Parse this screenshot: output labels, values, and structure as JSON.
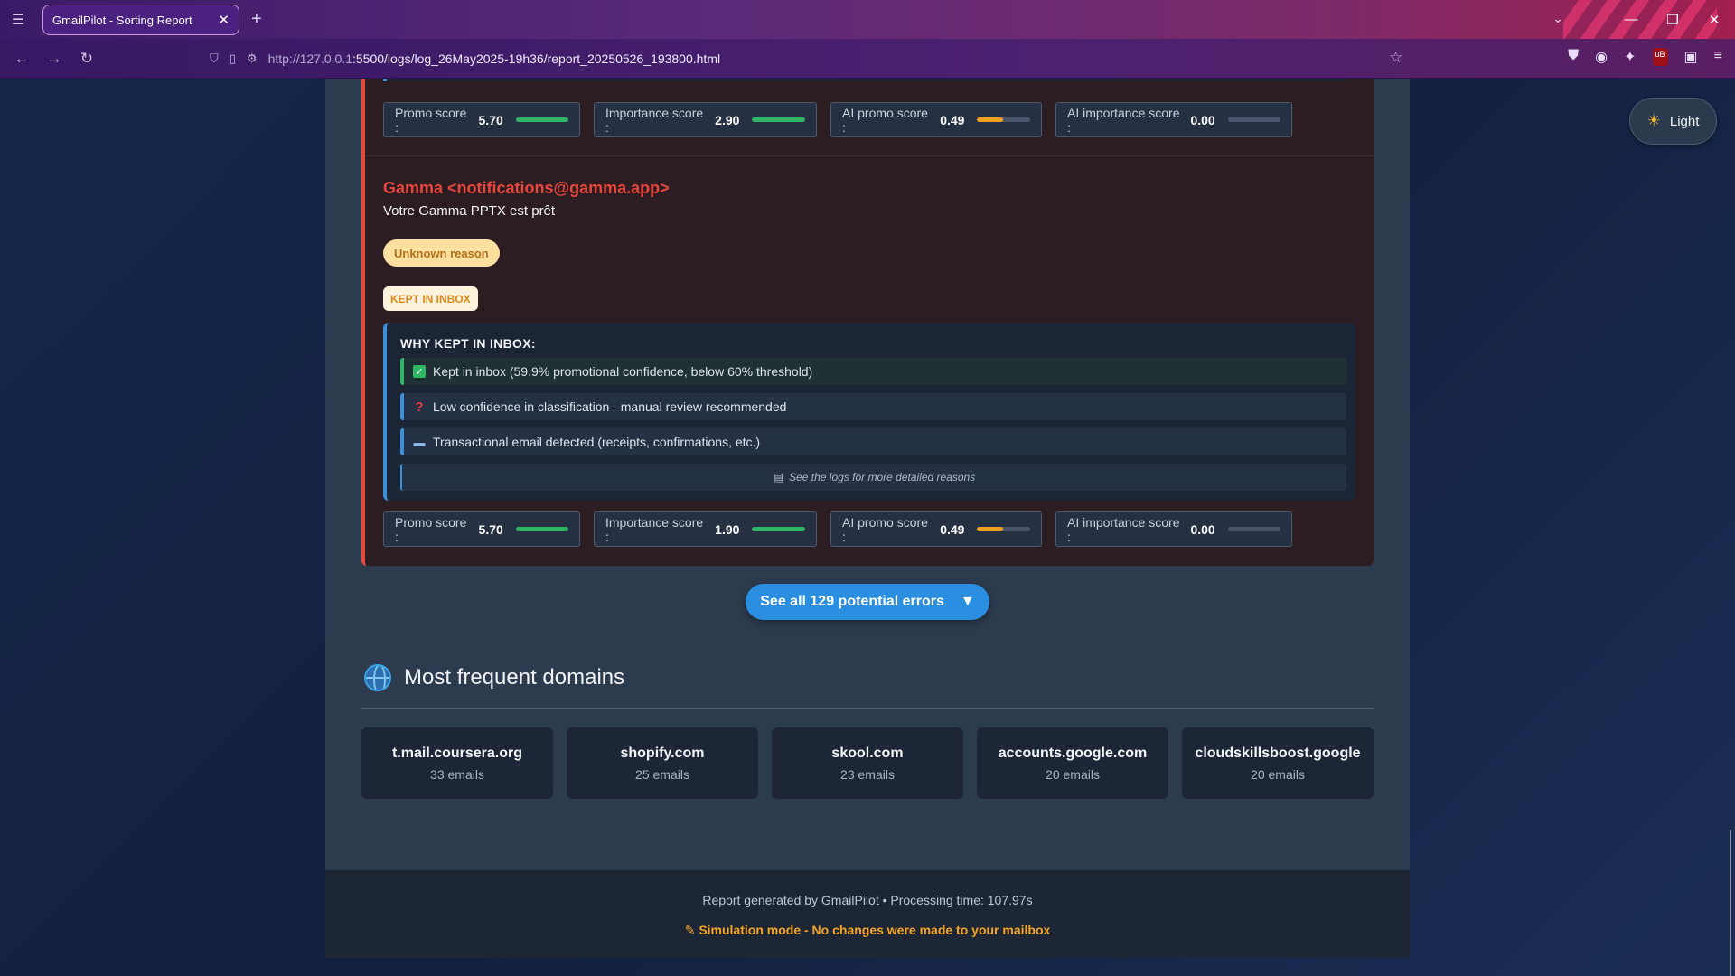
{
  "browser": {
    "tab_title": "GmailPilot - Sorting Report",
    "url_host": "http://127.0.0.1",
    "url_rest": ":5500/logs/log_26May2025-19h36/report_20250526_193800.html"
  },
  "theme_toggle": {
    "label": "Light",
    "icon": "sun-icon"
  },
  "previous_email": {
    "scores": [
      {
        "label": "Promo score :",
        "value": "5.70",
        "fill": 1.0,
        "color": "#2fb766"
      },
      {
        "label": "Importance score :",
        "value": "2.90",
        "fill": 1.0,
        "color": "#2fb766"
      },
      {
        "label": "AI promo score :",
        "value": "0.49",
        "fill": 0.49,
        "color": "#f0a020"
      },
      {
        "label": "AI importance score :",
        "value": "0.00",
        "fill": 0.0,
        "color": "#2fb766"
      }
    ]
  },
  "email": {
    "sender": "Gamma <notifications@gamma.app>",
    "subject": "Votre Gamma PPTX est prêt",
    "reason_badge": "Unknown reason",
    "status_badge": "KEPT IN INBOX",
    "why_title": "WHY KEPT IN INBOX:",
    "why_items": [
      {
        "icon": "check-icon",
        "text": "Kept in inbox (59.9% promotional confidence, below 60% threshold)"
      },
      {
        "icon": "question-icon",
        "text": "Low confidence in classification - manual review recommended"
      },
      {
        "icon": "card-icon",
        "text": "Transactional email detected (receipts, confirmations, etc.)"
      }
    ],
    "why_footer": "See the logs for more detailed reasons",
    "scores": [
      {
        "label": "Promo score :",
        "value": "5.70",
        "fill": 1.0,
        "color": "#2fb766"
      },
      {
        "label": "Importance score :",
        "value": "1.90",
        "fill": 1.0,
        "color": "#2fb766"
      },
      {
        "label": "AI promo score :",
        "value": "0.49",
        "fill": 0.49,
        "color": "#f0a020"
      },
      {
        "label": "AI importance score :",
        "value": "0.00",
        "fill": 0.0,
        "color": "#2fb766"
      }
    ]
  },
  "see_all": {
    "label": "See all 129 potential errors",
    "arrow": "▼"
  },
  "domains": {
    "title": "Most frequent domains",
    "items": [
      {
        "name": "t.mail.coursera.org",
        "count": "33 emails"
      },
      {
        "name": "shopify.com",
        "count": "25 emails"
      },
      {
        "name": "skool.com",
        "count": "23 emails"
      },
      {
        "name": "accounts.google.com",
        "count": "20 emails"
      },
      {
        "name": "cloudskillsboost.google",
        "count": "20 emails"
      }
    ]
  },
  "footer": {
    "generated": "Report generated by GmailPilot • Processing time: 107.97s",
    "simulation": "Simulation mode - No changes were made to your mailbox"
  }
}
